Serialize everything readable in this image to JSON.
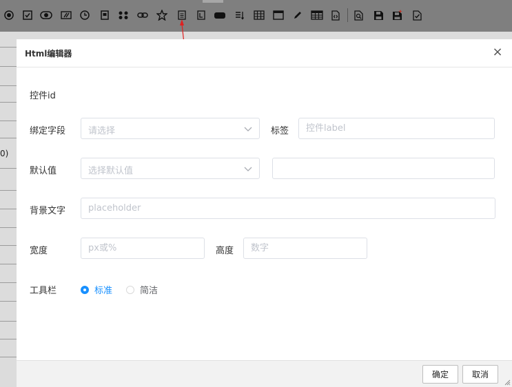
{
  "background": {
    "side_value": "0)"
  },
  "toolbar": {
    "buttons": [
      {
        "name": "radio-icon"
      },
      {
        "name": "checkbox-icon"
      },
      {
        "name": "toggle-icon"
      },
      {
        "name": "text-edit-icon"
      },
      {
        "name": "clock-icon"
      },
      {
        "name": "frame-icon"
      },
      {
        "name": "group-icon"
      },
      {
        "name": "link-icon"
      },
      {
        "name": "star-icon"
      },
      {
        "name": "html-editor-icon"
      },
      {
        "name": "label-icon"
      },
      {
        "name": "button-icon"
      },
      {
        "name": "list-icon"
      },
      {
        "name": "table-icon"
      },
      {
        "name": "window-icon"
      },
      {
        "name": "pen-icon"
      },
      {
        "name": "grid-icon"
      },
      {
        "name": "code-file-icon"
      },
      {
        "name": "preview-icon"
      },
      {
        "name": "save-icon"
      },
      {
        "name": "save-as-icon"
      },
      {
        "name": "check-icon"
      }
    ]
  },
  "dialog": {
    "title": "Html编辑器",
    "close": "×",
    "control_id_label": "控件id",
    "bind_field_label": "绑定字段",
    "bind_field_placeholder": "请选择",
    "tag_label": "标签",
    "tag_placeholder": "控件label",
    "default_label": "默认值",
    "default_placeholder": "选择默认值",
    "default_value": "",
    "bg_text_label": "背景文字",
    "bg_text_placeholder": "placeholder",
    "width_label": "宽度",
    "width_placeholder": "px或%",
    "height_label": "高度",
    "height_placeholder": "数字",
    "toolbar_label": "工具栏",
    "toolbar_options": [
      "标准",
      "简洁"
    ],
    "toolbar_selected": "标准",
    "ok": "确定",
    "cancel": "取消"
  },
  "colors": {
    "accent": "#1890ff",
    "arrow": "#e02020"
  }
}
